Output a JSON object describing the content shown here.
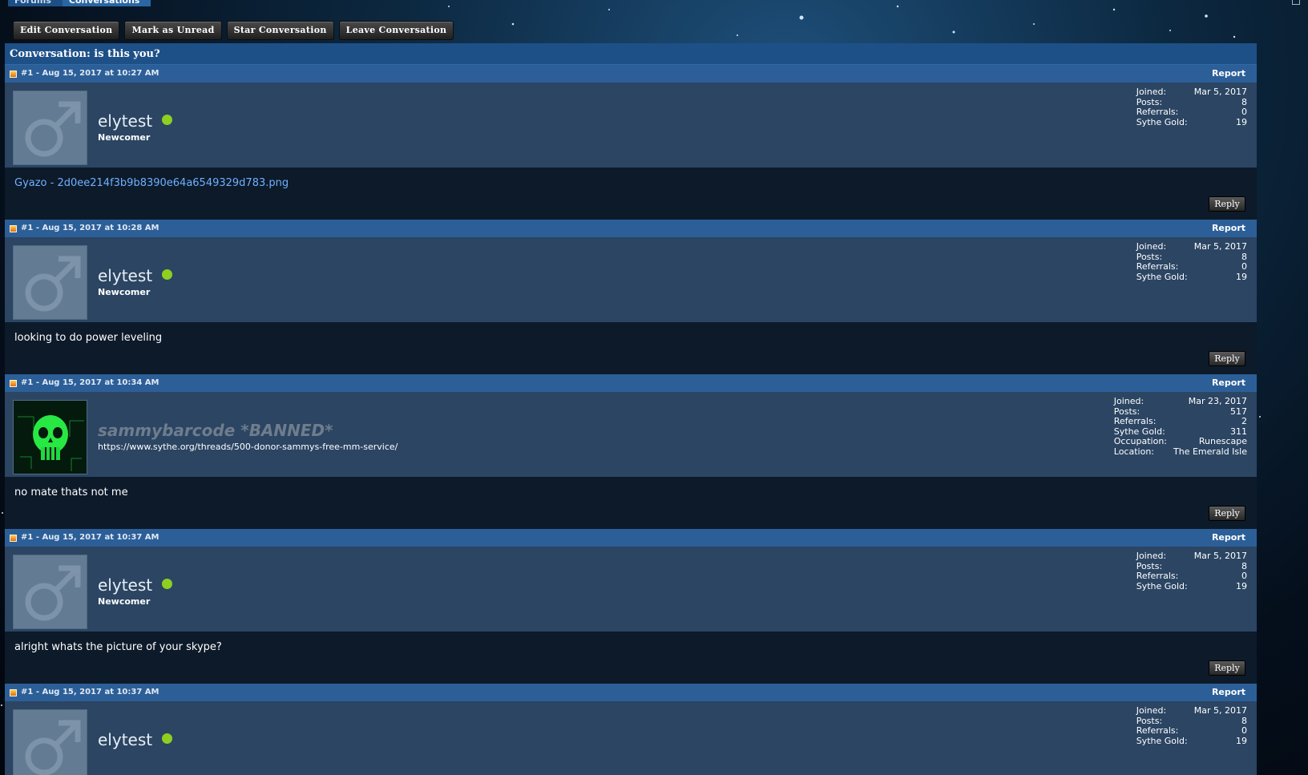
{
  "breadcrumb": {
    "items": [
      "Forums",
      "Conversations"
    ]
  },
  "toolbar": {
    "edit": "Edit Conversation",
    "mark_unread": "Mark as Unread",
    "star": "Star Conversation",
    "leave": "Leave Conversation"
  },
  "conversation": {
    "title": "Conversation: is this you?"
  },
  "labels": {
    "report": "Report",
    "reply": "Reply",
    "joined": "Joined:",
    "posts": "Posts:",
    "referrals": "Referrals:",
    "gold": "Sythe Gold:",
    "occupation": "Occupation:",
    "location": "Location:"
  },
  "posts": [
    {
      "meta": "#1 - Aug 15, 2017 at 10:27 AM",
      "username": "elytest",
      "user_title": "Newcomer",
      "joined": "Mar 5, 2017",
      "post_count": "8",
      "referrals": "0",
      "gold": "19",
      "message": "Gyazo - 2d0ee214f3b9b8390e64a6549329d783.png",
      "message_is_link": true
    },
    {
      "meta": "#1 - Aug 15, 2017 at 10:28 AM",
      "username": "elytest",
      "user_title": "Newcomer",
      "joined": "Mar 5, 2017",
      "post_count": "8",
      "referrals": "0",
      "gold": "19",
      "message": "looking to do power leveling"
    },
    {
      "meta": "#1 - Aug 15, 2017 at 10:34 AM",
      "username": "sammybarcode *BANNED*",
      "user_sig": "https://www.sythe.org/threads/500-donor-sammys-free-mm-service/",
      "joined": "Mar 23, 2017",
      "post_count": "517",
      "referrals": "2",
      "gold": "311",
      "occupation": "Runescape",
      "location": "The Emerald Isle",
      "message": "no mate thats not me"
    },
    {
      "meta": "#1 - Aug 15, 2017 at 10:37 AM",
      "username": "elytest",
      "user_title": "Newcomer",
      "joined": "Mar 5, 2017",
      "post_count": "8",
      "referrals": "0",
      "gold": "19",
      "message": "alright whats the picture of your skype?"
    },
    {
      "meta": "#1 - Aug 15, 2017 at 10:37 AM",
      "username": "elytest",
      "joined": "Mar 5, 2017",
      "post_count": "8",
      "referrals": "0",
      "gold": "19"
    }
  ],
  "colors": {
    "header_blue": "#2c5f98",
    "user_panel": "#2b4563",
    "message_bg": "#0d1a2a",
    "online": "#8ecf21",
    "link": "#6fb0ff"
  }
}
